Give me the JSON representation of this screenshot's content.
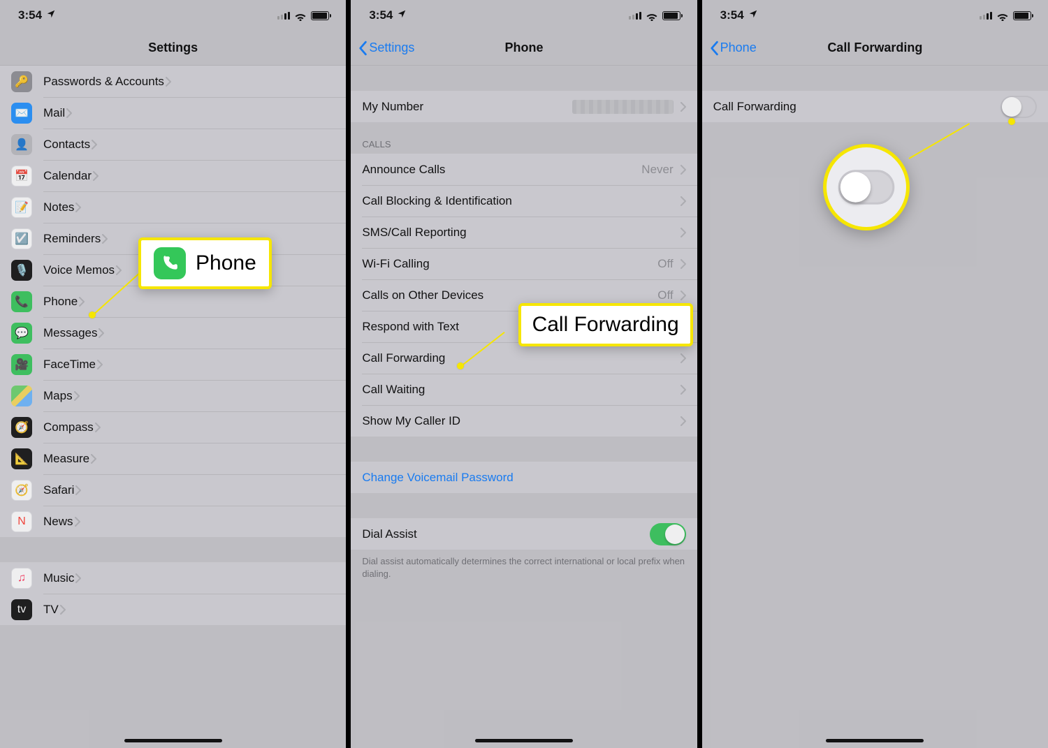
{
  "status": {
    "time": "3:54",
    "location_icon": "location-arrow"
  },
  "colors": {
    "highlight": "#f6e600",
    "link": "#0a7aff",
    "switch_on": "#34c759"
  },
  "pane1": {
    "title": "Settings",
    "items": [
      {
        "icon": "key-icon",
        "icon_class": "ic-key",
        "glyph": "🔑",
        "label": "Passwords & Accounts"
      },
      {
        "icon": "mail-icon",
        "icon_class": "ic-mail",
        "glyph": "✉️",
        "label": "Mail"
      },
      {
        "icon": "contacts-icon",
        "icon_class": "ic-contact",
        "glyph": "👤",
        "label": "Contacts"
      },
      {
        "icon": "calendar-icon",
        "icon_class": "ic-cal",
        "glyph": "📅",
        "label": "Calendar"
      },
      {
        "icon": "notes-icon",
        "icon_class": "ic-notes",
        "glyph": "📝",
        "label": "Notes"
      },
      {
        "icon": "reminders-icon",
        "icon_class": "ic-rem",
        "glyph": "☑️",
        "label": "Reminders"
      },
      {
        "icon": "voice-memos-icon",
        "icon_class": "ic-voice",
        "glyph": "🎙️",
        "label": "Voice Memos"
      },
      {
        "icon": "phone-icon",
        "icon_class": "ic-phone",
        "glyph": "📞",
        "label": "Phone"
      },
      {
        "icon": "messages-icon",
        "icon_class": "ic-msg",
        "glyph": "💬",
        "label": "Messages"
      },
      {
        "icon": "facetime-icon",
        "icon_class": "ic-ft",
        "glyph": "🎥",
        "label": "FaceTime"
      },
      {
        "icon": "maps-icon",
        "icon_class": "ic-maps",
        "glyph": "",
        "label": "Maps"
      },
      {
        "icon": "compass-icon",
        "icon_class": "ic-compass",
        "glyph": "🧭",
        "label": "Compass"
      },
      {
        "icon": "measure-icon",
        "icon_class": "ic-measure",
        "glyph": "📐",
        "label": "Measure"
      },
      {
        "icon": "safari-icon",
        "icon_class": "ic-safari",
        "glyph": "🧭",
        "label": "Safari"
      },
      {
        "icon": "news-icon",
        "icon_class": "ic-news",
        "glyph": "N",
        "label": "News"
      }
    ],
    "items2": [
      {
        "icon": "music-icon",
        "icon_class": "ic-music",
        "glyph": "♫",
        "label": "Music"
      },
      {
        "icon": "tv-icon",
        "icon_class": "ic-tv",
        "glyph": "tv",
        "label": "TV"
      }
    ],
    "callout": {
      "icon_glyph": "📞",
      "label": "Phone"
    }
  },
  "pane2": {
    "back": "Settings",
    "title": "Phone",
    "my_number_label": "My Number",
    "my_number_value": "",
    "calls_header": "CALLS",
    "calls": [
      {
        "label": "Announce Calls",
        "value": "Never"
      },
      {
        "label": "Call Blocking & Identification",
        "value": ""
      },
      {
        "label": "SMS/Call Reporting",
        "value": ""
      },
      {
        "label": "Wi-Fi Calling",
        "value": "Off"
      },
      {
        "label": "Calls on Other Devices",
        "value": "Off"
      },
      {
        "label": "Respond with Text",
        "value": ""
      },
      {
        "label": "Call Forwarding",
        "value": ""
      },
      {
        "label": "Call Waiting",
        "value": ""
      },
      {
        "label": "Show My Caller ID",
        "value": ""
      }
    ],
    "change_voicemail": "Change Voicemail Password",
    "dial_assist_label": "Dial Assist",
    "dial_assist_on": true,
    "dial_assist_footer": "Dial assist automatically determines the correct international or local prefix when dialing.",
    "callout": "Call Forwarding"
  },
  "pane3": {
    "back": "Phone",
    "title": "Call Forwarding",
    "row_label": "Call Forwarding",
    "toggle_on": false
  }
}
